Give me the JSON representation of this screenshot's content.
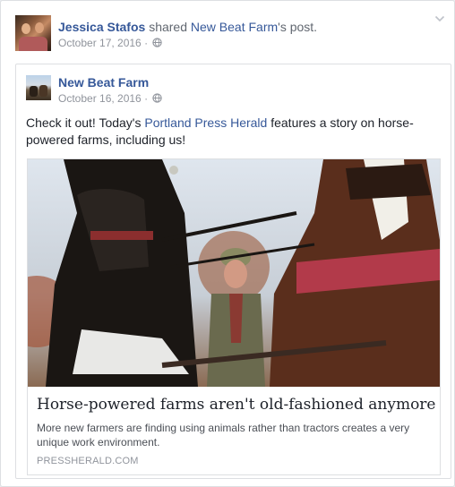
{
  "outer_post": {
    "actor_name": "Jessica Stafos",
    "shared_text": "shared",
    "shared_page": "New Beat Farm",
    "possessive": "'s post.",
    "date": "October 17, 2016"
  },
  "inner_post": {
    "page_name": "New Beat Farm",
    "date": "October 16, 2016",
    "text_before": "Check it out! Today's ",
    "text_link": "Portland Press Herald",
    "text_after": " features a story on horse-powered farms, including us!"
  },
  "link_preview": {
    "title": "Horse-powered farms aren't old-fashioned anymore",
    "description": "More new farmers are finding using animals rather than tractors creates a very unique work environment.",
    "domain": "PRESSHERALD.COM"
  },
  "colors": {
    "link_blue": "#365899",
    "meta_gray": "#90949c",
    "border": "#dddfe2"
  },
  "icons": [
    "globe-icon",
    "chevron-down-icon"
  ]
}
